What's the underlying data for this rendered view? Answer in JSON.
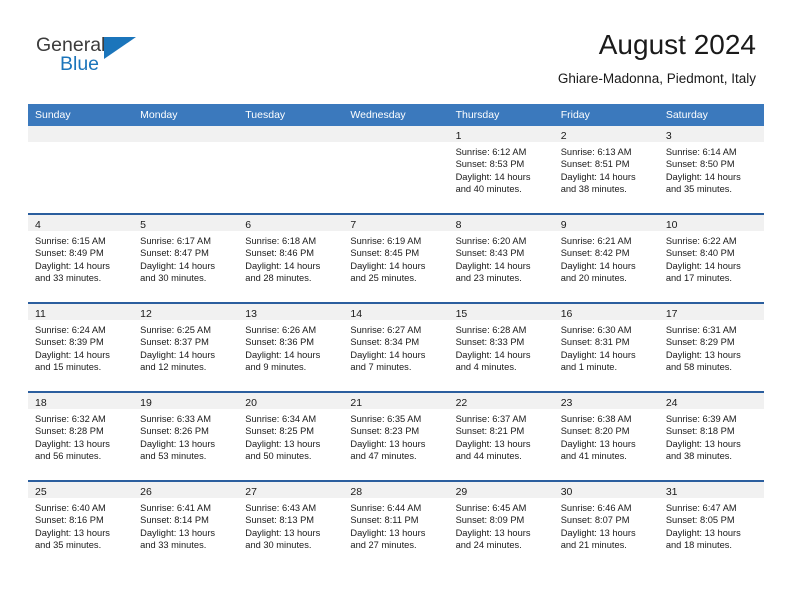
{
  "brand": {
    "name_part1": "General",
    "name_part2": "Blue",
    "triangle_color": "#1b75bb"
  },
  "header": {
    "title": "August 2024",
    "subtitle": "Ghiare-Madonna, Piedmont, Italy"
  },
  "theme": {
    "header_blue": "#3b79bd",
    "row_border_blue": "#2b5e9e",
    "day_strip_gray": "#f1f1f1"
  },
  "weekdays": [
    "Sunday",
    "Monday",
    "Tuesday",
    "Wednesday",
    "Thursday",
    "Friday",
    "Saturday"
  ],
  "weeks": [
    [
      {
        "day": "",
        "empty": true
      },
      {
        "day": "",
        "empty": true
      },
      {
        "day": "",
        "empty": true
      },
      {
        "day": "",
        "empty": true
      },
      {
        "day": "1",
        "sunrise": "Sunrise: 6:12 AM",
        "sunset": "Sunset: 8:53 PM",
        "daylight_line1": "Daylight: 14 hours",
        "daylight_line2": "and 40 minutes."
      },
      {
        "day": "2",
        "sunrise": "Sunrise: 6:13 AM",
        "sunset": "Sunset: 8:51 PM",
        "daylight_line1": "Daylight: 14 hours",
        "daylight_line2": "and 38 minutes."
      },
      {
        "day": "3",
        "sunrise": "Sunrise: 6:14 AM",
        "sunset": "Sunset: 8:50 PM",
        "daylight_line1": "Daylight: 14 hours",
        "daylight_line2": "and 35 minutes."
      }
    ],
    [
      {
        "day": "4",
        "sunrise": "Sunrise: 6:15 AM",
        "sunset": "Sunset: 8:49 PM",
        "daylight_line1": "Daylight: 14 hours",
        "daylight_line2": "and 33 minutes."
      },
      {
        "day": "5",
        "sunrise": "Sunrise: 6:17 AM",
        "sunset": "Sunset: 8:47 PM",
        "daylight_line1": "Daylight: 14 hours",
        "daylight_line2": "and 30 minutes."
      },
      {
        "day": "6",
        "sunrise": "Sunrise: 6:18 AM",
        "sunset": "Sunset: 8:46 PM",
        "daylight_line1": "Daylight: 14 hours",
        "daylight_line2": "and 28 minutes."
      },
      {
        "day": "7",
        "sunrise": "Sunrise: 6:19 AM",
        "sunset": "Sunset: 8:45 PM",
        "daylight_line1": "Daylight: 14 hours",
        "daylight_line2": "and 25 minutes."
      },
      {
        "day": "8",
        "sunrise": "Sunrise: 6:20 AM",
        "sunset": "Sunset: 8:43 PM",
        "daylight_line1": "Daylight: 14 hours",
        "daylight_line2": "and 23 minutes."
      },
      {
        "day": "9",
        "sunrise": "Sunrise: 6:21 AM",
        "sunset": "Sunset: 8:42 PM",
        "daylight_line1": "Daylight: 14 hours",
        "daylight_line2": "and 20 minutes."
      },
      {
        "day": "10",
        "sunrise": "Sunrise: 6:22 AM",
        "sunset": "Sunset: 8:40 PM",
        "daylight_line1": "Daylight: 14 hours",
        "daylight_line2": "and 17 minutes."
      }
    ],
    [
      {
        "day": "11",
        "sunrise": "Sunrise: 6:24 AM",
        "sunset": "Sunset: 8:39 PM",
        "daylight_line1": "Daylight: 14 hours",
        "daylight_line2": "and 15 minutes."
      },
      {
        "day": "12",
        "sunrise": "Sunrise: 6:25 AM",
        "sunset": "Sunset: 8:37 PM",
        "daylight_line1": "Daylight: 14 hours",
        "daylight_line2": "and 12 minutes."
      },
      {
        "day": "13",
        "sunrise": "Sunrise: 6:26 AM",
        "sunset": "Sunset: 8:36 PM",
        "daylight_line1": "Daylight: 14 hours",
        "daylight_line2": "and 9 minutes."
      },
      {
        "day": "14",
        "sunrise": "Sunrise: 6:27 AM",
        "sunset": "Sunset: 8:34 PM",
        "daylight_line1": "Daylight: 14 hours",
        "daylight_line2": "and 7 minutes."
      },
      {
        "day": "15",
        "sunrise": "Sunrise: 6:28 AM",
        "sunset": "Sunset: 8:33 PM",
        "daylight_line1": "Daylight: 14 hours",
        "daylight_line2": "and 4 minutes."
      },
      {
        "day": "16",
        "sunrise": "Sunrise: 6:30 AM",
        "sunset": "Sunset: 8:31 PM",
        "daylight_line1": "Daylight: 14 hours",
        "daylight_line2": "and 1 minute."
      },
      {
        "day": "17",
        "sunrise": "Sunrise: 6:31 AM",
        "sunset": "Sunset: 8:29 PM",
        "daylight_line1": "Daylight: 13 hours",
        "daylight_line2": "and 58 minutes."
      }
    ],
    [
      {
        "day": "18",
        "sunrise": "Sunrise: 6:32 AM",
        "sunset": "Sunset: 8:28 PM",
        "daylight_line1": "Daylight: 13 hours",
        "daylight_line2": "and 56 minutes."
      },
      {
        "day": "19",
        "sunrise": "Sunrise: 6:33 AM",
        "sunset": "Sunset: 8:26 PM",
        "daylight_line1": "Daylight: 13 hours",
        "daylight_line2": "and 53 minutes."
      },
      {
        "day": "20",
        "sunrise": "Sunrise: 6:34 AM",
        "sunset": "Sunset: 8:25 PM",
        "daylight_line1": "Daylight: 13 hours",
        "daylight_line2": "and 50 minutes."
      },
      {
        "day": "21",
        "sunrise": "Sunrise: 6:35 AM",
        "sunset": "Sunset: 8:23 PM",
        "daylight_line1": "Daylight: 13 hours",
        "daylight_line2": "and 47 minutes."
      },
      {
        "day": "22",
        "sunrise": "Sunrise: 6:37 AM",
        "sunset": "Sunset: 8:21 PM",
        "daylight_line1": "Daylight: 13 hours",
        "daylight_line2": "and 44 minutes."
      },
      {
        "day": "23",
        "sunrise": "Sunrise: 6:38 AM",
        "sunset": "Sunset: 8:20 PM",
        "daylight_line1": "Daylight: 13 hours",
        "daylight_line2": "and 41 minutes."
      },
      {
        "day": "24",
        "sunrise": "Sunrise: 6:39 AM",
        "sunset": "Sunset: 8:18 PM",
        "daylight_line1": "Daylight: 13 hours",
        "daylight_line2": "and 38 minutes."
      }
    ],
    [
      {
        "day": "25",
        "sunrise": "Sunrise: 6:40 AM",
        "sunset": "Sunset: 8:16 PM",
        "daylight_line1": "Daylight: 13 hours",
        "daylight_line2": "and 35 minutes."
      },
      {
        "day": "26",
        "sunrise": "Sunrise: 6:41 AM",
        "sunset": "Sunset: 8:14 PM",
        "daylight_line1": "Daylight: 13 hours",
        "daylight_line2": "and 33 minutes."
      },
      {
        "day": "27",
        "sunrise": "Sunrise: 6:43 AM",
        "sunset": "Sunset: 8:13 PM",
        "daylight_line1": "Daylight: 13 hours",
        "daylight_line2": "and 30 minutes."
      },
      {
        "day": "28",
        "sunrise": "Sunrise: 6:44 AM",
        "sunset": "Sunset: 8:11 PM",
        "daylight_line1": "Daylight: 13 hours",
        "daylight_line2": "and 27 minutes."
      },
      {
        "day": "29",
        "sunrise": "Sunrise: 6:45 AM",
        "sunset": "Sunset: 8:09 PM",
        "daylight_line1": "Daylight: 13 hours",
        "daylight_line2": "and 24 minutes."
      },
      {
        "day": "30",
        "sunrise": "Sunrise: 6:46 AM",
        "sunset": "Sunset: 8:07 PM",
        "daylight_line1": "Daylight: 13 hours",
        "daylight_line2": "and 21 minutes."
      },
      {
        "day": "31",
        "sunrise": "Sunrise: 6:47 AM",
        "sunset": "Sunset: 8:05 PM",
        "daylight_line1": "Daylight: 13 hours",
        "daylight_line2": "and 18 minutes."
      }
    ]
  ]
}
